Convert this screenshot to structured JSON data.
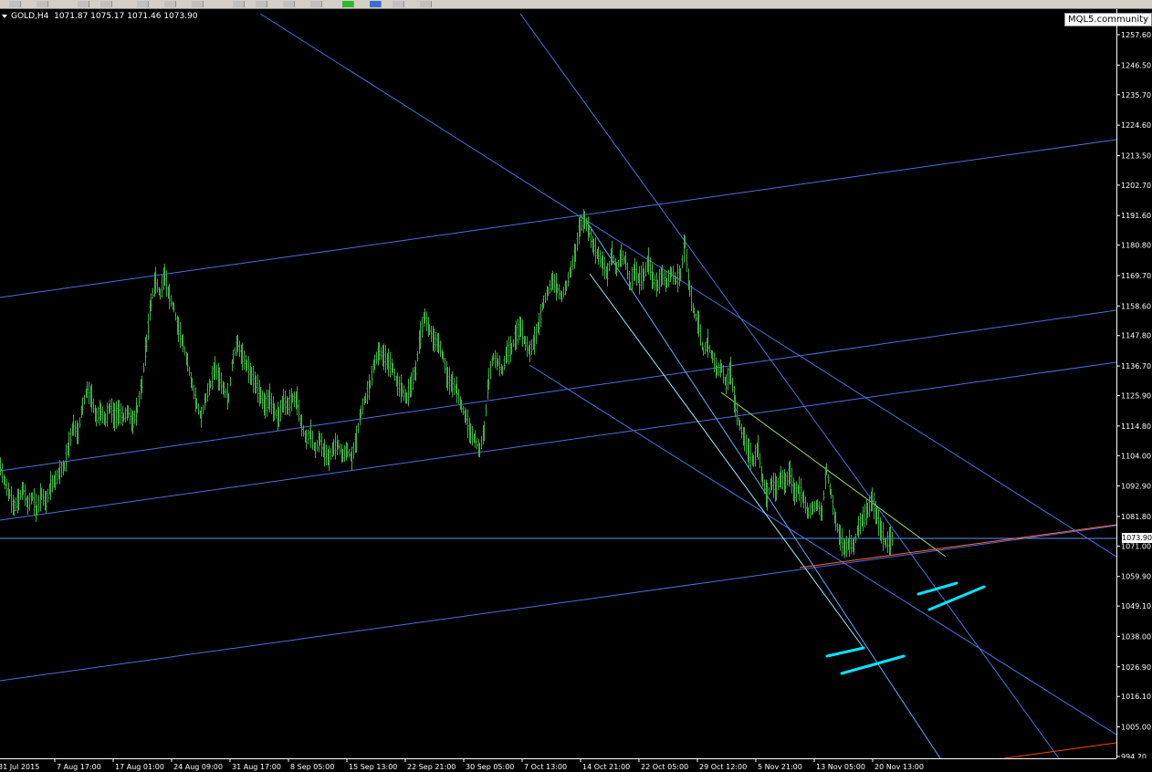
{
  "chart_header": {
    "symbol": "GOLD,H4",
    "ohlc": "1071.87 1075.17 1071.46 1073.90"
  },
  "watermark": "MQL5.community",
  "current_price": "1073.90",
  "colors": {
    "background": "#000000",
    "candles": "#3cb043",
    "channel_lines": "#4169e1",
    "support_line": "#ff4500",
    "markers": "#00e5ff",
    "axis_text": "#ffffff"
  },
  "chart_data": {
    "type": "line",
    "title": "",
    "xlabel": "",
    "ylabel": "",
    "ylim": [
      990,
      1265
    ],
    "grid": false,
    "y_ticks": [
      "1257.60",
      "1246.50",
      "1235.70",
      "1224.60",
      "1213.50",
      "1202.70",
      "1191.60",
      "1180.80",
      "1169.70",
      "1158.60",
      "1147.80",
      "1136.70",
      "1125.90",
      "1114.80",
      "1104.00",
      "1092.90",
      "1081.80",
      "1071.00",
      "1059.90",
      "1049.10",
      "1038.00",
      "1026.90",
      "1016.10",
      "1005.00",
      "994.20"
    ],
    "x_ticks": [
      "31 Jul 2015",
      "7 Aug 17:00",
      "17 Aug 01:00",
      "24 Aug 09:00",
      "31 Aug 17:00",
      "8 Sep 05:00",
      "15 Sep 13:00",
      "22 Sep 21:00",
      "30 Sep 05:00",
      "7 Oct 13:00",
      "14 Oct 21:00",
      "22 Oct 05:00",
      "29 Oct 12:00",
      "5 Nov 21:00",
      "13 Nov 05:00",
      "20 Nov 13:00"
    ],
    "series": [
      {
        "type": "price",
        "points": [
          [
            0,
            1100
          ],
          [
            5,
            1094
          ],
          [
            10,
            1090
          ],
          [
            15,
            1085
          ],
          [
            20,
            1088
          ],
          [
            25,
            1092
          ],
          [
            30,
            1086
          ],
          [
            35,
            1089
          ],
          [
            40,
            1084
          ],
          [
            45,
            1090
          ],
          [
            50,
            1087
          ],
          [
            55,
            1093
          ],
          [
            60,
            1095
          ],
          [
            65,
            1098
          ],
          [
            70,
            1100
          ],
          [
            75,
            1108
          ],
          [
            80,
            1115
          ],
          [
            85,
            1112
          ],
          [
            90,
            1122
          ],
          [
            95,
            1128
          ],
          [
            100,
            1125
          ],
          [
            105,
            1118
          ],
          [
            110,
            1120
          ],
          [
            115,
            1117
          ],
          [
            120,
            1122
          ],
          [
            125,
            1118
          ],
          [
            130,
            1120
          ],
          [
            135,
            1118
          ],
          [
            140,
            1120
          ],
          [
            145,
            1116
          ],
          [
            150,
            1121
          ],
          [
            155,
            1130
          ],
          [
            160,
            1145
          ],
          [
            165,
            1160
          ],
          [
            170,
            1168
          ],
          [
            175,
            1163
          ],
          [
            180,
            1170
          ],
          [
            185,
            1162
          ],
          [
            190,
            1158
          ],
          [
            195,
            1150
          ],
          [
            200,
            1145
          ],
          [
            205,
            1138
          ],
          [
            210,
            1130
          ],
          [
            215,
            1123
          ],
          [
            220,
            1118
          ],
          [
            225,
            1125
          ],
          [
            230,
            1130
          ],
          [
            235,
            1136
          ],
          [
            240,
            1132
          ],
          [
            245,
            1128
          ],
          [
            250,
            1125
          ],
          [
            255,
            1140
          ],
          [
            260,
            1145
          ],
          [
            265,
            1140
          ],
          [
            270,
            1137
          ],
          [
            275,
            1133
          ],
          [
            280,
            1130
          ],
          [
            285,
            1126
          ],
          [
            290,
            1122
          ],
          [
            295,
            1125
          ],
          [
            300,
            1120
          ],
          [
            305,
            1118
          ],
          [
            310,
            1124
          ],
          [
            315,
            1122
          ],
          [
            320,
            1125
          ],
          [
            325,
            1124
          ],
          [
            330,
            1115
          ],
          [
            335,
            1110
          ],
          [
            340,
            1112
          ],
          [
            345,
            1106
          ],
          [
            350,
            1110
          ],
          [
            355,
            1105
          ],
          [
            360,
            1103
          ],
          [
            365,
            1107
          ],
          [
            370,
            1108
          ],
          [
            375,
            1104
          ],
          [
            380,
            1106
          ],
          [
            385,
            1103
          ],
          [
            390,
            1110
          ],
          [
            395,
            1120
          ],
          [
            400,
            1125
          ],
          [
            405,
            1130
          ],
          [
            410,
            1138
          ],
          [
            415,
            1142
          ],
          [
            420,
            1140
          ],
          [
            425,
            1138
          ],
          [
            430,
            1136
          ],
          [
            435,
            1130
          ],
          [
            440,
            1128
          ],
          [
            445,
            1125
          ],
          [
            450,
            1130
          ],
          [
            455,
            1135
          ],
          [
            460,
            1148
          ],
          [
            465,
            1155
          ],
          [
            470,
            1150
          ],
          [
            475,
            1146
          ],
          [
            480,
            1145
          ],
          [
            485,
            1140
          ],
          [
            490,
            1132
          ],
          [
            495,
            1130
          ],
          [
            500,
            1128
          ],
          [
            505,
            1122
          ],
          [
            510,
            1118
          ],
          [
            515,
            1112
          ],
          [
            520,
            1110
          ],
          [
            525,
            1106
          ],
          [
            530,
            1113
          ],
          [
            535,
            1132
          ],
          [
            540,
            1140
          ],
          [
            545,
            1138
          ],
          [
            550,
            1135
          ],
          [
            555,
            1142
          ],
          [
            560,
            1143
          ],
          [
            565,
            1148
          ],
          [
            570,
            1151
          ],
          [
            575,
            1145
          ],
          [
            580,
            1142
          ],
          [
            585,
            1146
          ],
          [
            590,
            1152
          ],
          [
            595,
            1160
          ],
          [
            600,
            1164
          ],
          [
            605,
            1168
          ],
          [
            610,
            1165
          ],
          [
            615,
            1162
          ],
          [
            620,
            1166
          ],
          [
            625,
            1172
          ],
          [
            630,
            1178
          ],
          [
            635,
            1188
          ],
          [
            640,
            1190
          ],
          [
            645,
            1186
          ],
          [
            650,
            1180
          ],
          [
            655,
            1177
          ],
          [
            660,
            1174
          ],
          [
            665,
            1170
          ],
          [
            670,
            1178
          ],
          [
            675,
            1172
          ],
          [
            680,
            1177
          ],
          [
            685,
            1175
          ],
          [
            690,
            1166
          ],
          [
            695,
            1172
          ],
          [
            700,
            1168
          ],
          [
            705,
            1170
          ],
          [
            710,
            1175
          ],
          [
            715,
            1168
          ],
          [
            720,
            1166
          ],
          [
            725,
            1170
          ],
          [
            730,
            1167
          ],
          [
            735,
            1171
          ],
          [
            740,
            1168
          ],
          [
            745,
            1170
          ],
          [
            750,
            1182
          ],
          [
            755,
            1165
          ],
          [
            760,
            1156
          ],
          [
            765,
            1152
          ],
          [
            770,
            1142
          ],
          [
            775,
            1145
          ],
          [
            780,
            1140
          ],
          [
            785,
            1135
          ],
          [
            790,
            1136
          ],
          [
            795,
            1130
          ],
          [
            800,
            1135
          ],
          [
            805,
            1122
          ],
          [
            810,
            1115
          ],
          [
            815,
            1110
          ],
          [
            820,
            1105
          ],
          [
            825,
            1102
          ],
          [
            830,
            1107
          ],
          [
            835,
            1095
          ],
          [
            840,
            1089
          ],
          [
            845,
            1094
          ],
          [
            850,
            1092
          ],
          [
            855,
            1096
          ],
          [
            860,
            1094
          ],
          [
            865,
            1098
          ],
          [
            870,
            1090
          ],
          [
            875,
            1092
          ],
          [
            880,
            1088
          ],
          [
            885,
            1083
          ],
          [
            890,
            1085
          ],
          [
            895,
            1086
          ],
          [
            900,
            1083
          ],
          [
            905,
            1099
          ],
          [
            910,
            1090
          ],
          [
            915,
            1080
          ],
          [
            920,
            1074
          ],
          [
            925,
            1070
          ],
          [
            930,
            1072
          ],
          [
            935,
            1071
          ],
          [
            940,
            1078
          ],
          [
            945,
            1081
          ],
          [
            950,
            1084
          ],
          [
            955,
            1088
          ],
          [
            960,
            1082
          ],
          [
            965,
            1076
          ],
          [
            970,
            1072
          ],
          [
            975,
            1073
          ],
          [
            978,
            1074
          ]
        ]
      }
    ]
  }
}
